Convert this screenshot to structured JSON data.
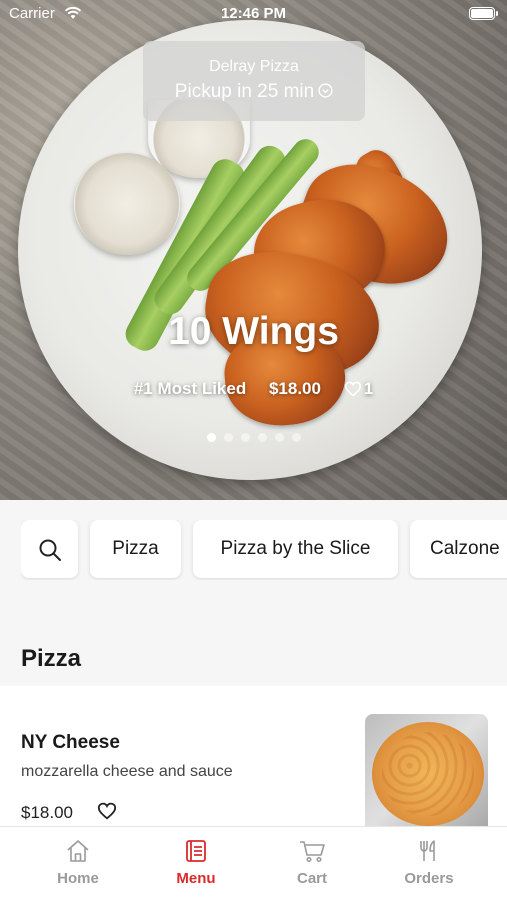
{
  "status_bar": {
    "carrier": "Carrier",
    "time": "12:46 PM"
  },
  "store": {
    "name": "Delray Pizza",
    "pickup": "Pickup in 25 min"
  },
  "hero": {
    "title": "10 Wings",
    "tag": "#1 Most Liked",
    "price": "$18.00",
    "likes": "1",
    "carousel": {
      "pages": 6,
      "active_index": 0
    }
  },
  "categories": [
    "Pizza",
    "Pizza by the Slice",
    "Calzone"
  ],
  "section": {
    "title": "Pizza"
  },
  "items": [
    {
      "name": "NY Cheese",
      "description": "mozzarella cheese and sauce",
      "price": "$18.00"
    }
  ],
  "tabs": [
    {
      "label": "Home",
      "icon": "home-icon",
      "active": false
    },
    {
      "label": "Menu",
      "icon": "menu-icon",
      "active": true
    },
    {
      "label": "Cart",
      "icon": "cart-icon",
      "active": false
    },
    {
      "label": "Orders",
      "icon": "utensils-icon",
      "active": false
    }
  ],
  "colors": {
    "accent": "#d92b2b",
    "inactive": "#9a9a9a"
  }
}
